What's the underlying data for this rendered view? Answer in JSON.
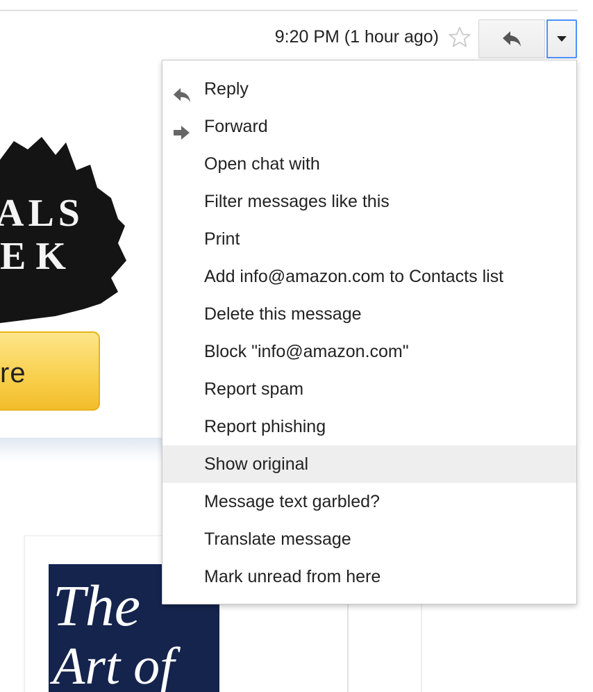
{
  "header": {
    "timestamp": "9:20 PM (1 hour ago)",
    "star_icon": "star-outline-icon",
    "reply_icon": "reply-arrow-icon",
    "more_icon": "dropdown-caret-icon"
  },
  "background_content": {
    "banner_text_lines": [
      "ALS",
      "EK"
    ],
    "button_label": "re",
    "book_title_lines": [
      "The",
      "Art of"
    ],
    "colors": {
      "button_yellow": "#f8cf4b",
      "book_navy": "#15244d"
    }
  },
  "menu": {
    "items": [
      {
        "label": "Reply",
        "icon": "reply-icon",
        "highlighted": false
      },
      {
        "label": "Forward",
        "icon": "forward-icon",
        "highlighted": false
      },
      {
        "label": "Open chat with",
        "highlighted": false
      },
      {
        "label": "Filter messages like this",
        "highlighted": false
      },
      {
        "label": "Print",
        "highlighted": false
      },
      {
        "label": "Add info@amazon.com to Contacts list",
        "highlighted": false
      },
      {
        "label": "Delete this message",
        "highlighted": false
      },
      {
        "label": "Block \"info@amazon.com\"",
        "highlighted": false
      },
      {
        "label": "Report spam",
        "highlighted": false
      },
      {
        "label": "Report phishing",
        "highlighted": false
      },
      {
        "label": "Show original",
        "highlighted": true
      },
      {
        "label": "Message text garbled?",
        "highlighted": false
      },
      {
        "label": "Translate message",
        "highlighted": false
      },
      {
        "label": "Mark unread from here",
        "highlighted": false
      }
    ]
  },
  "colors": {
    "focus_border": "#4d90fe",
    "highlight": "#eeeeee",
    "icon_gray": "#666666"
  }
}
